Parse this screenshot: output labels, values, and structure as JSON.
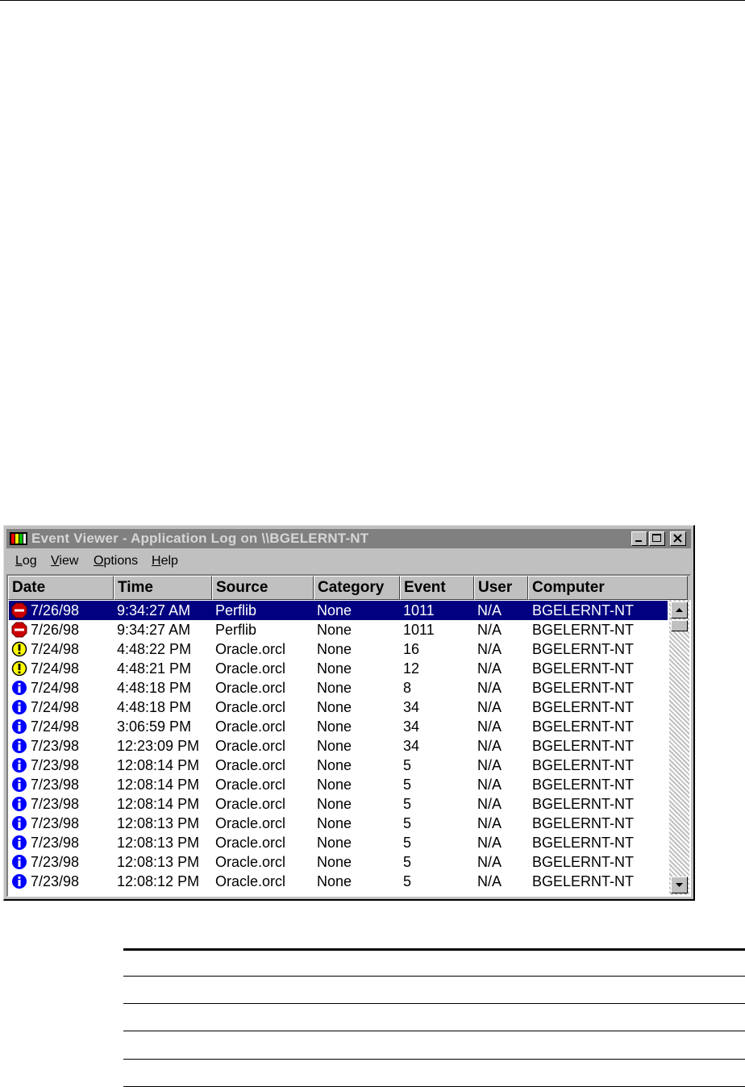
{
  "window": {
    "title": "Event Viewer - Application Log on \\\\BGELERNT-NT",
    "controls": {
      "minimize": "_",
      "maximize": "□",
      "close": "×"
    }
  },
  "menu": [
    {
      "key": "L",
      "rest": "og"
    },
    {
      "key": "V",
      "rest": "iew"
    },
    {
      "key": "O",
      "rest": "ptions"
    },
    {
      "key": "H",
      "rest": "elp"
    }
  ],
  "columns": [
    "Date",
    "Time",
    "Source",
    "Category",
    "Event",
    "User",
    "Computer"
  ],
  "rows": [
    {
      "icon": "stop-icon",
      "date": "7/26/98",
      "time": "9:34:27 AM",
      "source": "Perflib",
      "category": "None",
      "event": "1011",
      "user": "N/A",
      "computer": "BGELERNT-NT",
      "selected": true
    },
    {
      "icon": "stop-icon",
      "date": "7/26/98",
      "time": "9:34:27 AM",
      "source": "Perflib",
      "category": "None",
      "event": "1011",
      "user": "N/A",
      "computer": "BGELERNT-NT"
    },
    {
      "icon": "warning-icon",
      "date": "7/24/98",
      "time": "4:48:22 PM",
      "source": "Oracle.orcl",
      "category": "None",
      "event": "16",
      "user": "N/A",
      "computer": "BGELERNT-NT"
    },
    {
      "icon": "warning-icon",
      "date": "7/24/98",
      "time": "4:48:21 PM",
      "source": "Oracle.orcl",
      "category": "None",
      "event": "12",
      "user": "N/A",
      "computer": "BGELERNT-NT"
    },
    {
      "icon": "information-icon",
      "date": "7/24/98",
      "time": "4:48:18 PM",
      "source": "Oracle.orcl",
      "category": "None",
      "event": "8",
      "user": "N/A",
      "computer": "BGELERNT-NT"
    },
    {
      "icon": "information-icon",
      "date": "7/24/98",
      "time": "4:48:18 PM",
      "source": "Oracle.orcl",
      "category": "None",
      "event": "34",
      "user": "N/A",
      "computer": "BGELERNT-NT"
    },
    {
      "icon": "information-icon",
      "date": "7/24/98",
      "time": "3:06:59 PM",
      "source": "Oracle.orcl",
      "category": "None",
      "event": "34",
      "user": "N/A",
      "computer": "BGELERNT-NT"
    },
    {
      "icon": "information-icon",
      "date": "7/23/98",
      "time": "12:23:09 PM",
      "source": "Oracle.orcl",
      "category": "None",
      "event": "34",
      "user": "N/A",
      "computer": "BGELERNT-NT"
    },
    {
      "icon": "information-icon",
      "date": "7/23/98",
      "time": "12:08:14 PM",
      "source": "Oracle.orcl",
      "category": "None",
      "event": "5",
      "user": "N/A",
      "computer": "BGELERNT-NT"
    },
    {
      "icon": "information-icon",
      "date": "7/23/98",
      "time": "12:08:14 PM",
      "source": "Oracle.orcl",
      "category": "None",
      "event": "5",
      "user": "N/A",
      "computer": "BGELERNT-NT"
    },
    {
      "icon": "information-icon",
      "date": "7/23/98",
      "time": "12:08:14 PM",
      "source": "Oracle.orcl",
      "category": "None",
      "event": "5",
      "user": "N/A",
      "computer": "BGELERNT-NT"
    },
    {
      "icon": "information-icon",
      "date": "7/23/98",
      "time": "12:08:13 PM",
      "source": "Oracle.orcl",
      "category": "None",
      "event": "5",
      "user": "N/A",
      "computer": "BGELERNT-NT"
    },
    {
      "icon": "information-icon",
      "date": "7/23/98",
      "time": "12:08:13 PM",
      "source": "Oracle.orcl",
      "category": "None",
      "event": "5",
      "user": "N/A",
      "computer": "BGELERNT-NT"
    },
    {
      "icon": "information-icon",
      "date": "7/23/98",
      "time": "12:08:13 PM",
      "source": "Oracle.orcl",
      "category": "None",
      "event": "5",
      "user": "N/A",
      "computer": "BGELERNT-NT"
    },
    {
      "icon": "information-icon",
      "date": "7/23/98",
      "time": "12:08:12 PM",
      "source": "Oracle.orcl",
      "category": "None",
      "event": "5",
      "user": "N/A",
      "computer": "BGELERNT-NT"
    }
  ],
  "colors": {
    "selection": "#000080",
    "stop": "#cc0000",
    "warning": "#ffff00",
    "information": "#0000ff"
  }
}
